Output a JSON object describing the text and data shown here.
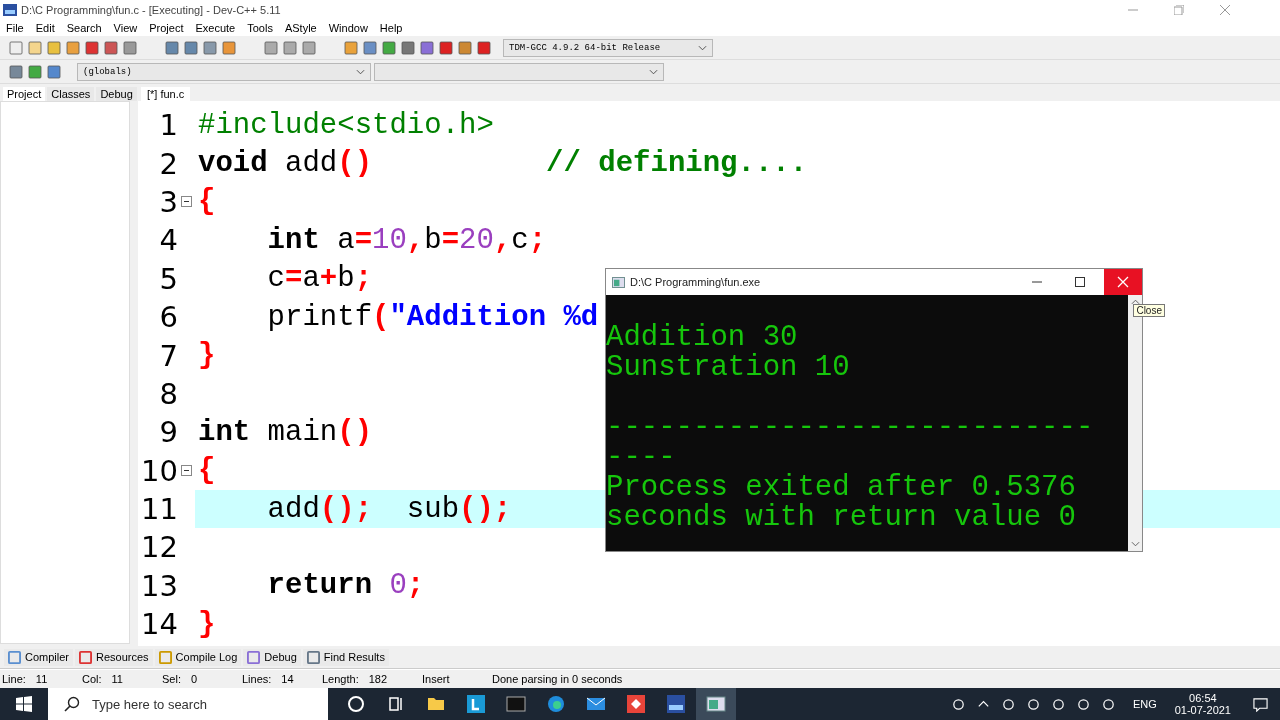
{
  "window": {
    "title": "D:\\C Programming\\fun.c - [Executing] - Dev-C++ 5.11"
  },
  "menu": [
    "File",
    "Edit",
    "Search",
    "View",
    "Project",
    "Execute",
    "Tools",
    "AStyle",
    "Window",
    "Help"
  ],
  "compiler_select": {
    "value": "TDM-GCC 4.9.2 64-bit Release"
  },
  "scope_select": {
    "value": "(globals)"
  },
  "side_tabs": [
    {
      "label": "Project",
      "selected": true
    },
    {
      "label": "Classes",
      "selected": false
    },
    {
      "label": "Debug",
      "selected": false
    }
  ],
  "editor_tabs": [
    {
      "label": "[*] fun.c",
      "selected": true
    }
  ],
  "code_lines": [
    {
      "number": "1",
      "fold": false,
      "current": false,
      "tokens": [
        {
          "kind": "preproc",
          "text": "#include<stdio.h>"
        }
      ]
    },
    {
      "number": "2",
      "fold": false,
      "current": false,
      "tokens": [
        {
          "kind": "keyword",
          "text": "void"
        },
        {
          "kind": "ident",
          "text": " add"
        },
        {
          "kind": "symbol",
          "text": "()"
        },
        {
          "kind": "comment",
          "text": "          // defining...."
        }
      ]
    },
    {
      "number": "3",
      "fold": true,
      "current": false,
      "tokens": [
        {
          "kind": "symbol",
          "text": "{"
        }
      ]
    },
    {
      "number": "4",
      "fold": false,
      "current": false,
      "tokens": [
        {
          "kind": "keyword",
          "text": "    int"
        },
        {
          "kind": "ident",
          "text": " a"
        },
        {
          "kind": "symbol",
          "text": "="
        },
        {
          "kind": "number",
          "text": "10"
        },
        {
          "kind": "symbol",
          "text": ","
        },
        {
          "kind": "ident",
          "text": "b"
        },
        {
          "kind": "symbol",
          "text": "="
        },
        {
          "kind": "number",
          "text": "20"
        },
        {
          "kind": "symbol",
          "text": ","
        },
        {
          "kind": "ident",
          "text": "c"
        },
        {
          "kind": "symbol",
          "text": ";"
        }
      ]
    },
    {
      "number": "5",
      "fold": false,
      "current": false,
      "tokens": [
        {
          "kind": "ident",
          "text": "    c"
        },
        {
          "kind": "symbol",
          "text": "="
        },
        {
          "kind": "ident",
          "text": "a"
        },
        {
          "kind": "symbol",
          "text": "+"
        },
        {
          "kind": "ident",
          "text": "b"
        },
        {
          "kind": "symbol",
          "text": ";"
        }
      ]
    },
    {
      "number": "6",
      "fold": false,
      "current": false,
      "tokens": [
        {
          "kind": "ident",
          "text": "    printf"
        },
        {
          "kind": "symbol",
          "text": "("
        },
        {
          "kind": "string",
          "text": "\"Addition %d"
        }
      ]
    },
    {
      "number": "7",
      "fold": false,
      "current": false,
      "tokens": [
        {
          "kind": "symbol",
          "text": "}"
        }
      ]
    },
    {
      "number": "8",
      "fold": false,
      "current": false
    },
    {
      "number": "9",
      "fold": false,
      "current": false,
      "tokens": [
        {
          "kind": "keyword",
          "text": "int"
        },
        {
          "kind": "ident",
          "text": " main"
        },
        {
          "kind": "symbol",
          "text": "()"
        }
      ]
    },
    {
      "number": "10",
      "fold": true,
      "current": false,
      "tokens": [
        {
          "kind": "symbol",
          "text": "{"
        }
      ]
    },
    {
      "number": "11",
      "fold": false,
      "current": true,
      "tokens": [
        {
          "kind": "ident",
          "text": "    add"
        },
        {
          "kind": "symbol",
          "text": "();"
        },
        {
          "kind": "ident",
          "text": "  sub"
        },
        {
          "kind": "symbol",
          "text": "();"
        }
      ]
    },
    {
      "number": "12",
      "fold": false,
      "current": false
    },
    {
      "number": "13",
      "fold": false,
      "current": false,
      "tokens": [
        {
          "kind": "keyword",
          "text": "    return"
        },
        {
          "kind": "number",
          "text": " 0"
        },
        {
          "kind": "symbol",
          "text": ";"
        }
      ]
    },
    {
      "number": "14",
      "fold": false,
      "current": false,
      "tokens": [
        {
          "kind": "symbol",
          "text": "}"
        }
      ]
    }
  ],
  "console": {
    "title": "D:\\C Programming\\fun.exe",
    "lines": [
      "Addition 30",
      "Sunstration 10",
      "----------------------------",
      "----",
      "Process exited after 0.5376",
      "seconds with return value 0"
    ],
    "tooltip": "Close"
  },
  "bottom_tabs": [
    "Compiler",
    "Resources",
    "Compile Log",
    "Debug",
    "Find Results"
  ],
  "status_bar": [
    {
      "label": "Line:",
      "value": "11"
    },
    {
      "label": "Col:",
      "value": "11"
    },
    {
      "label": "Sel:",
      "value": "0"
    },
    {
      "label": "Lines:",
      "value": "14"
    },
    {
      "label": "Length:",
      "value": "182"
    },
    {
      "value": "Insert"
    },
    {
      "value": "Done parsing in 0 seconds"
    }
  ],
  "taskbar": {
    "search_placeholder": "Type here to search",
    "language": "ENG",
    "time": "06:54",
    "date": "01-07-2021"
  }
}
